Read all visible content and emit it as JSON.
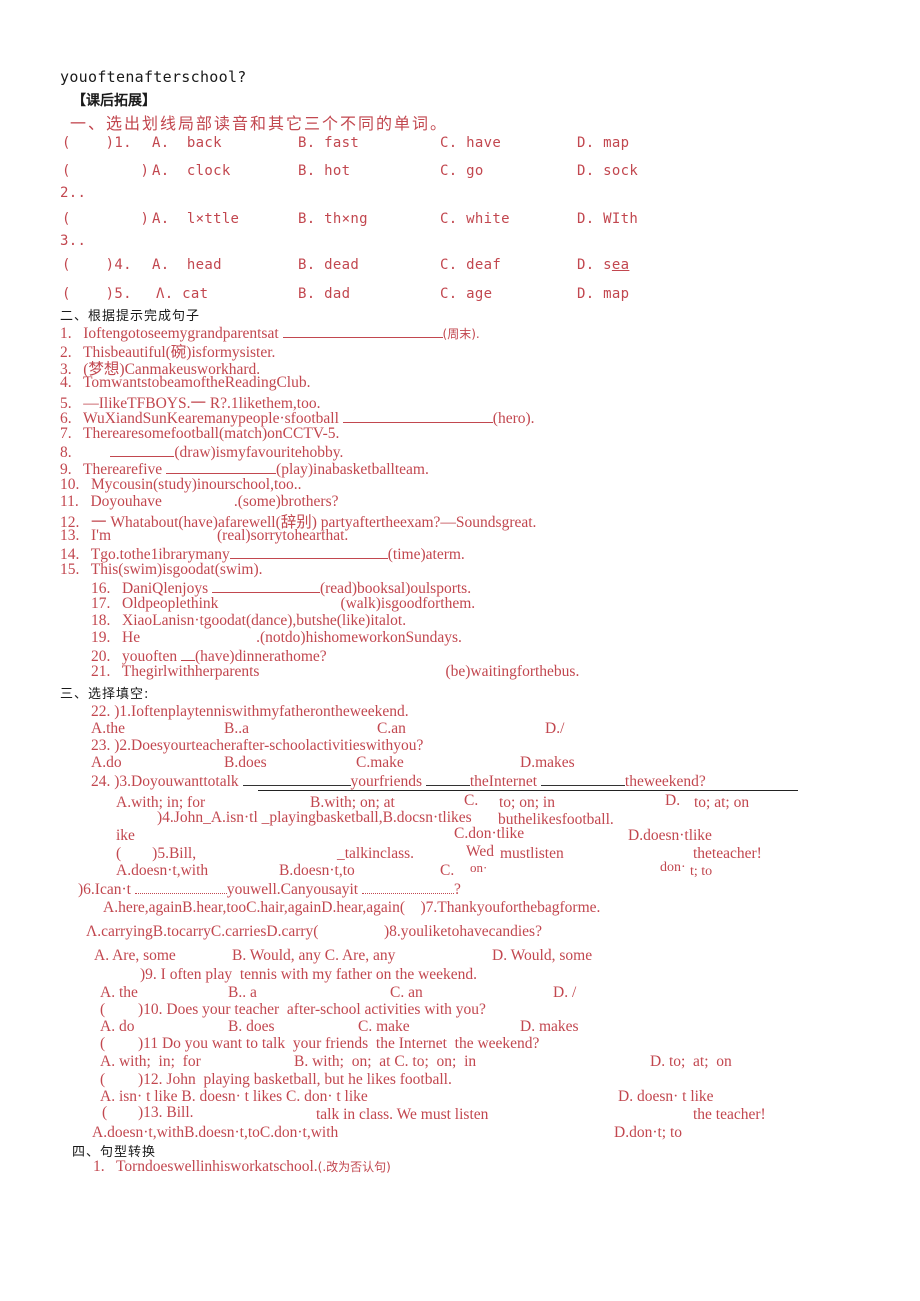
{
  "intro_line": "youoftenafterschool?",
  "heading_main": "【课后拓展】",
  "section1": {
    "title": "一、选出划线局部读音和其它三个不同的单词。",
    "rows": [
      {
        "paren": "(    )1.",
        "a": "A.  back",
        "b": "B. fast",
        "c": "C. have",
        "d": "D. map"
      },
      {
        "paren": "(        )",
        "a": "A.  clock",
        "b": "B. hot",
        "c": "C. go",
        "d": "D. sock",
        "after": "2.."
      },
      {
        "paren": "(        )",
        "a": "A.  l×ttle",
        "b": "B. th×ng",
        "c": "C. white",
        "d": "D. WIth",
        "after": "3.."
      },
      {
        "paren": "(    )4.",
        "a": "A.  head",
        "b": "B. dead",
        "c": "C. deaf",
        "d_prefix": "D. s",
        "d_underlined": "ea"
      },
      {
        "paren": "(    )5.",
        "a": "Λ. cat",
        "b": "B. dad",
        "c": "C. age",
        "d": "D. map"
      }
    ]
  },
  "section2": {
    "title": "二、根据提示完成句子",
    "items": [
      {
        "num": "1.",
        "text": "Ioftengotoseemygrandparentsat",
        "suffix": "(周末)."
      },
      {
        "num": "2.",
        "text": "Thisbeautiful(碗)isformysister."
      },
      {
        "num": "3.",
        "text": "(梦想)Canmakeusworkhard."
      },
      {
        "num": "4.",
        "text": "TomwantstobeamoftheReadingClub."
      },
      {
        "num": "5.",
        "text": "—IlikeTFBOYS.一 R?.1likethem,too."
      },
      {
        "num": "6.",
        "text": "WuXiandSunKearemanypeople·sfootball",
        "suffix": "(hero)."
      },
      {
        "num": "7.",
        "text": "Therearesomefootball(match)onCCTV-5."
      },
      {
        "num": "8.",
        "text": "",
        "suffix": "(draw)ismyfavouritehobby."
      },
      {
        "num": "9.",
        "text": "Therearefive",
        "suffix": "(play)inabasketballteam."
      },
      {
        "num": "10.",
        "text": "Mycousin(study)inourschool,too.."
      },
      {
        "num": "11.",
        "text": "Doyouhave",
        "suffix": ".(some)brothers?"
      },
      {
        "num": "12.",
        "text": "一 Whatabout(have)afarewell(辞别) partyaftertheexam?—Soundsgreat."
      },
      {
        "num": "13.",
        "text": "I'm",
        "suffix": "(real)sorrytohearthat."
      },
      {
        "num": "14.",
        "text": "Tgo.tothe1ibrarymany",
        "suffix": "(time)aterm."
      },
      {
        "num": "15.",
        "text": "This(swim)isgoodat(swim)."
      },
      {
        "num": "16.",
        "text": "DaniQlenjoys",
        "suffix": "(read)booksal)oulsports."
      },
      {
        "num": "17.",
        "text": "Oldpeoplethink",
        "suffix": "(walk)isgoodforthem."
      },
      {
        "num": "18.",
        "text": "XiaoLanisn·tgoodat(dance),butshe(like)italot."
      },
      {
        "num": "19.",
        "text": "He",
        "suffix": ".(notdo)hishomeworkonSundays."
      },
      {
        "num": "20.",
        "text": "youoften",
        "suffix": "(have)dinnerathome?"
      },
      {
        "num": "21.",
        "text": "Thegirlwithherparents",
        "suffix": "(be)waitingforthebus."
      }
    ]
  },
  "section3": {
    "title": "三、选择填空:",
    "q22": "22. )1.Ioftenplaytenniswithmyfatherontheweekend.",
    "q22_opts": [
      "A.the",
      "B..a",
      "C.an",
      "D./"
    ],
    "q23": "23. )2.Doesyourteacherafter-schoolactivitieswithyou?",
    "q23_opts": [
      "A.do",
      "B.does",
      "C.make",
      "D.makes"
    ],
    "q24": {
      "start": "24. )3.Doyouwanttotalk",
      "p1": "yourfriends",
      "p2": "theInternet",
      "p3": "theweekend?"
    },
    "q24_opts": [
      "A.with; in; for",
      "B.with; on; at",
      "C.",
      "to; on; in",
      "D.",
      "to; at; on"
    ],
    "q4_line1": ")4.John_A.isn·tl _playingbasketball,B.docsn·tlikes",
    "q4_line1b": "buthelikesfootball.",
    "q4_line2a": "ike",
    "q4_line2b": "C.don·tlike",
    "q4_line2c": "D.doesn·tlike",
    "q5_paren": "(        )5.Bill,",
    "q5_mid": "_talkinclass.",
    "q5_wed": "Wed",
    "q5_must": "mustlisten",
    "q5_end": "theteacher!",
    "q5_opts_a": "A.doesn·t,with",
    "q5_opts_b": "B.doesn·t,to",
    "q5_opts_c": "C.",
    "q5_opts_on": "on·",
    "q5_opts_don": "don·",
    "q5_opts_t": "t; to",
    "q6": ")6.Ican·t",
    "q6_mid": "youwell.Canyousayit",
    "q6_end": "?",
    "q6_opts": "A.here,againB.hear,tooC.hair,againD.hear,again(    )7.Thankyouforthebagforme.",
    "q7_opts": "Λ.carryingB.tocarryC.carriesD.carry(",
    "q8": ")8.youliketohavecandies?",
    "q8_opts": [
      "A. Are, some",
      "B. Would, any C. Are, any",
      "D. Would, some"
    ],
    "q9": ")9. I often play  tennis with my father on the weekend.",
    "q9_opts": [
      "A. the",
      "B.. a",
      "C. an",
      "D. /"
    ],
    "q10_paren": "(",
    "q10": ")10. Does your teacher  after-school activities with you?",
    "q10_opts": [
      "A. do",
      "B. does",
      "C. make",
      "D. makes"
    ],
    "q11_paren": "(",
    "q11": ")11 Do you want to talk  your friends  the Internet  the weekend?",
    "q11_opts": [
      "A. with;  in;  for",
      "B. with;  on;  at C. to;  on;  in",
      "D. to;  at;  on"
    ],
    "q12_paren": "(",
    "q12": ")12. John  playing basketball, but he likes football.",
    "q12_opts": [
      "A. isn· t like B. doesn· t likes C. don· t like",
      "D. doesn· t like"
    ],
    "q13_paren": "(",
    "q13": ")13. Bill.",
    "q13_mid": "talk in class. We must listen",
    "q13_end": "the teacher!",
    "q13_opts": [
      "A.doesn·t,withB.doesn·t,toC.don·t,with",
      "D.don·t; to"
    ]
  },
  "section4": {
    "title": "四、句型转换",
    "items": [
      {
        "num": "1.",
        "text": "Torndoeswellinhisworkatschool.",
        "suffix": "(.改为否认句)"
      }
    ]
  }
}
